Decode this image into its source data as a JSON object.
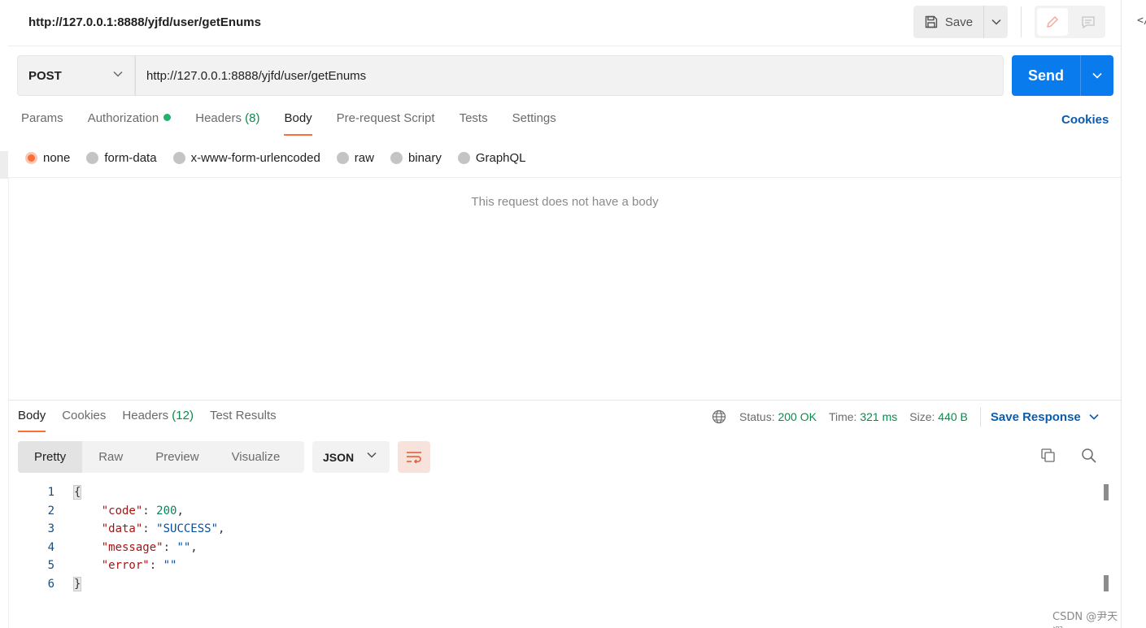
{
  "request": {
    "title": "http://127.0.0.1:8888/yjfd/user/getEnums",
    "save_label": "Save",
    "method": "POST",
    "url": "http://127.0.0.1:8888/yjfd/user/getEnums",
    "send_label": "Send"
  },
  "request_tabs": [
    {
      "label": "Params"
    },
    {
      "label": "Authorization"
    },
    {
      "label": "Headers",
      "count": "(8)"
    },
    {
      "label": "Body"
    },
    {
      "label": "Pre-request Script"
    },
    {
      "label": "Tests"
    },
    {
      "label": "Settings"
    }
  ],
  "active_request_tab": "Body",
  "cookies_label": "Cookies",
  "body_types": [
    "none",
    "form-data",
    "x-www-form-urlencoded",
    "raw",
    "binary",
    "GraphQL"
  ],
  "selected_body_type": "none",
  "no_body_message": "This request does not have a body",
  "response": {
    "tabs": [
      {
        "label": "Body"
      },
      {
        "label": "Cookies"
      },
      {
        "label": "Headers",
        "count": "(12)"
      },
      {
        "label": "Test Results"
      }
    ],
    "status_label": "Status:",
    "status_value": "200 OK",
    "time_label": "Time:",
    "time_value": "321 ms",
    "size_label": "Size:",
    "size_value": "440 B",
    "save_response_label": "Save Response",
    "view_modes": [
      "Pretty",
      "Raw",
      "Preview",
      "Visualize"
    ],
    "active_view_mode": "Pretty",
    "format": "JSON",
    "code_lines": [
      {
        "n": "1",
        "text": "{"
      },
      {
        "n": "2",
        "key": "\"code\"",
        "value": "200",
        "vtype": "n",
        "tail": ","
      },
      {
        "n": "3",
        "key": "\"data\"",
        "value": "\"SUCCESS\"",
        "vtype": "s",
        "tail": ","
      },
      {
        "n": "4",
        "key": "\"message\"",
        "value": "\"\"",
        "vtype": "s",
        "tail": ","
      },
      {
        "n": "5",
        "key": "\"error\"",
        "value": "\"\"",
        "vtype": "s",
        "tail": ""
      },
      {
        "n": "6",
        "text": "}"
      }
    ]
  },
  "watermark": "CSDN @尹天遐",
  "colors": {
    "accent": "#ff6c37",
    "send": "#097bed",
    "link": "#0b5cad",
    "success": "#0c8a4b"
  }
}
